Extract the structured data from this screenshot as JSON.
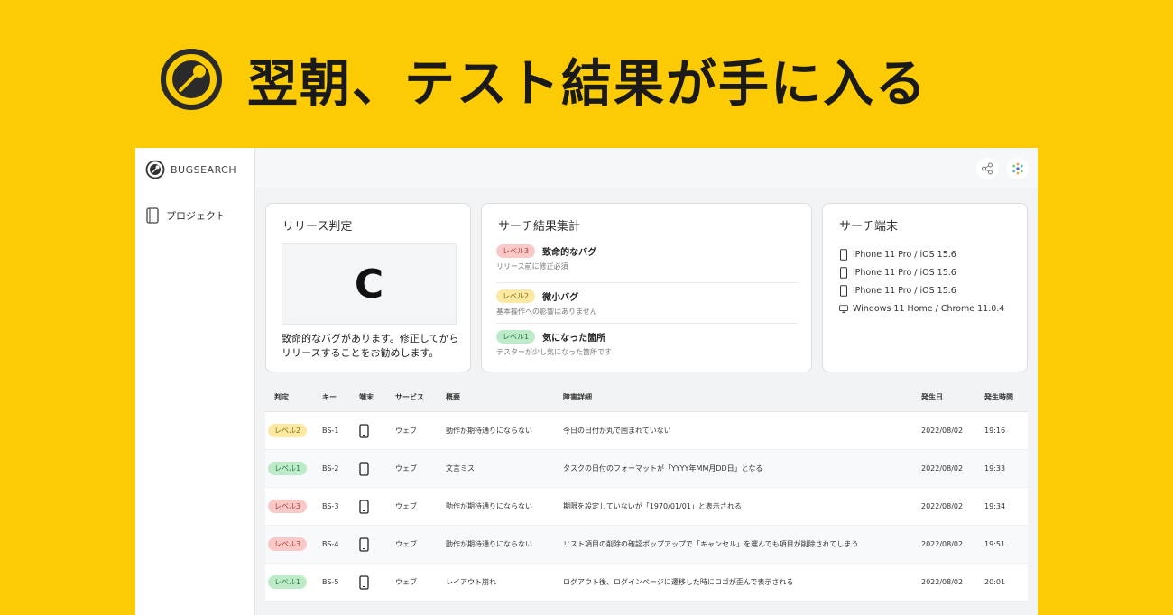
{
  "headline": {
    "text": "翌朝、テスト結果が手に入る"
  },
  "app": {
    "brand": "BUGSEARCH",
    "sidebar": {
      "items": [
        {
          "label": "プロジェクト",
          "icon": "folder-icon"
        }
      ]
    },
    "topbar": {
      "share_icon": "share-icon",
      "avatar_icon": "avatar-icon"
    }
  },
  "release": {
    "title": "リリース判定",
    "grade": "C",
    "description": "致命的なバグがあります。修正してからリリースすることをお勧めします。"
  },
  "summary": {
    "title": "サーチ結果集計",
    "items": [
      {
        "badge": "レベル3",
        "title": "致命的なバグ",
        "sub": "リリース前に修正必須"
      },
      {
        "badge": "レベル2",
        "title": "微小バグ",
        "sub": "基本操作への影響はありません"
      },
      {
        "badge": "レベル1",
        "title": "気になった箇所",
        "sub": "テスターが少し気になった箇所です"
      }
    ]
  },
  "devices": {
    "title": "サーチ端末",
    "items": [
      {
        "label": "iPhone 11 Pro / iOS 15.6",
        "icon": "phone-icon"
      },
      {
        "label": "iPhone 11 Pro / iOS 15.6",
        "icon": "phone-icon"
      },
      {
        "label": "iPhone 11 Pro / iOS 15.6",
        "icon": "phone-icon"
      },
      {
        "label": "Windows 11 Home / Chrome 11.0.4",
        "icon": "desktop-icon"
      }
    ]
  },
  "table": {
    "headers": [
      "判定",
      "キー",
      "端末",
      "サービス",
      "概要",
      "障害詳細",
      "発生日",
      "発生時間"
    ],
    "rows": [
      {
        "level": "レベル2",
        "key": "BS-1",
        "service": "ウェブ",
        "summary": "動作が期待通りにならない",
        "detail": "今日の日付が丸で囲まれていない",
        "date": "2022/08/02",
        "time": "19:16"
      },
      {
        "level": "レベル1",
        "key": "BS-2",
        "service": "ウェブ",
        "summary": "文言ミス",
        "detail": "タスクの日付のフォーマットが「YYYY年MM月DD日」となる",
        "date": "2022/08/02",
        "time": "19:33"
      },
      {
        "level": "レベル3",
        "key": "BS-3",
        "service": "ウェブ",
        "summary": "動作が期待通りにならない",
        "detail": "期限を設定していないが「1970/01/01」と表示される",
        "date": "2022/08/02",
        "time": "19:34"
      },
      {
        "level": "レベル3",
        "key": "BS-4",
        "service": "ウェブ",
        "summary": "動作が期待通りにならない",
        "detail": "リスト項目の削除の確認ポップアップで「キャンセル」を選んでも項目が削除されてしまう",
        "date": "2022/08/02",
        "time": "19:51"
      },
      {
        "level": "レベル1",
        "key": "BS-5",
        "service": "ウェブ",
        "summary": "レイアウト崩れ",
        "detail": "ログアウト後、ログインページに遷移した時にロゴが歪んで表示される",
        "date": "2022/08/02",
        "time": "20:01"
      }
    ]
  },
  "colors": {
    "background": "#FCCB03",
    "level3": "#F9C9C7",
    "level2": "#FBE9A4",
    "level1": "#BDEBC9"
  }
}
